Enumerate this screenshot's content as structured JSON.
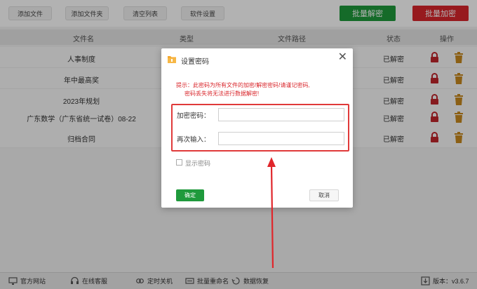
{
  "toolbar": {
    "buttons": [
      "添加文件",
      "添加文件夹",
      "清空列表",
      "软件设置"
    ],
    "batch_decrypt": "批量解密",
    "batch_encrypt": "批量加密"
  },
  "table": {
    "headers": [
      "文件名",
      "类型",
      "文件路径",
      "状态",
      "操作"
    ],
    "rows": [
      {
        "name": "人事制度",
        "status": "已解密"
      },
      {
        "name": "年中最高奖",
        "status": "已解密"
      },
      {
        "name": "2023年规划",
        "status": "已解密"
      },
      {
        "name": "广东数学（广东省统一试卷）08-22",
        "status": "已解密"
      },
      {
        "name": "归档合同",
        "status": "已解密"
      }
    ]
  },
  "dialog": {
    "title": "设置密码",
    "tip_line1": "提示：此密码为所有文件的加密/解密密码!请谨记密码,",
    "tip_line2": "密码丢失将无法进行数据解密!",
    "password_label": "加密密码：",
    "confirm_label": "再次输入：",
    "password_value": "",
    "confirm_value": "",
    "show_password_label": "显示密码",
    "ok_label": "确定",
    "cancel_label": "取消"
  },
  "statusbar": {
    "website": "官方网站",
    "service": "在线客服",
    "shutdown": "定时关机",
    "rename": "批量重命名",
    "recover": "数据恢复",
    "version": "版本：v3.6.7"
  },
  "colors": {
    "green": "#1f9a3c",
    "red": "#d9262b",
    "trash": "#c8891e"
  },
  "icons": {
    "lock": "lock-icon",
    "trash": "trash-icon",
    "folder": "folder-icon",
    "close": "close-icon"
  }
}
